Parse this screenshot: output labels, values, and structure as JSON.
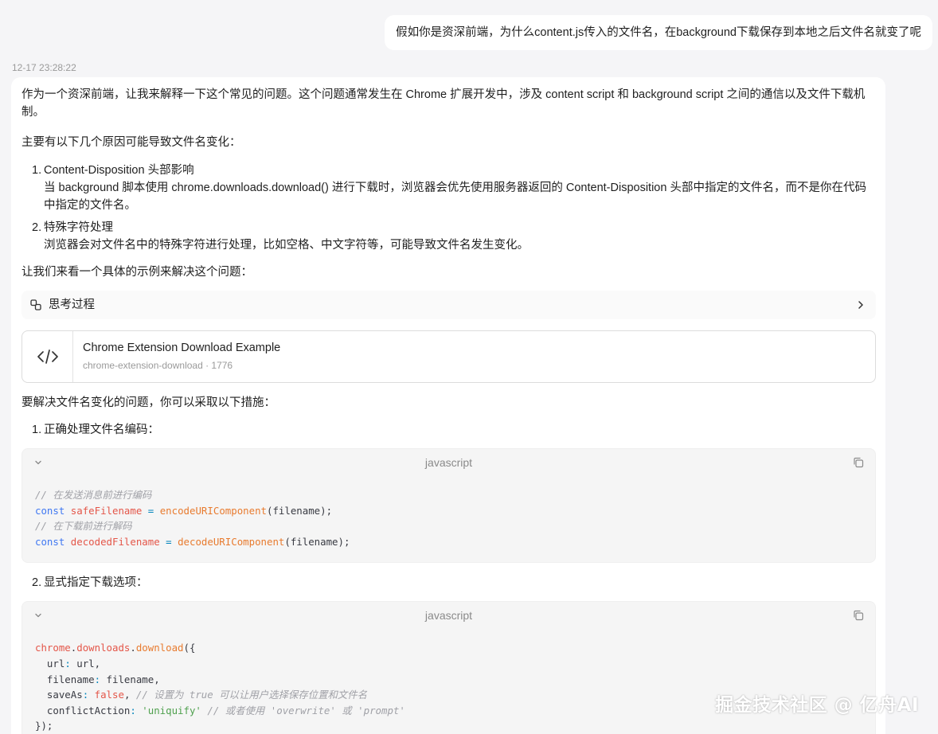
{
  "user_message": "假如你是资深前端，为什么content.js传入的文件名，在background下载保存到本地之后文件名就变了呢",
  "timestamp": "12-17 23:28:22",
  "answer": {
    "intro": "作为一个资深前端，让我来解释一下这个常见的问题。这个问题通常发生在 Chrome 扩展开发中，涉及 content script 和 background script 之间的通信以及文件下载机制。",
    "causes_lead": "主要有以下几个原因可能导致文件名变化：",
    "causes": [
      {
        "num": "1.",
        "title": "Content-Disposition 头部影响",
        "detail": "当 background 脚本使用 chrome.downloads.download() 进行下载时，浏览器会优先使用服务器返回的 Content-Disposition 头部中指定的文件名，而不是你在代码中指定的文件名。"
      },
      {
        "num": "2.",
        "title": "特殊字符处理",
        "detail": "浏览器会对文件名中的特殊字符进行处理，比如空格、中文字符等，可能导致文件名发生变化。"
      }
    ],
    "example_lead": "让我们来看一个具体的示例来解决这个问题：",
    "thinking_label": "思考过程",
    "artifact": {
      "title": "Chrome Extension Download Example",
      "subtitle": "chrome-extension-download · 1776"
    },
    "fix_lead": "要解决文件名变化的问题，你可以采取以下措施：",
    "steps": [
      {
        "num": "1.",
        "label": "正确处理文件名编码："
      },
      {
        "num": "2.",
        "label": "显式指定下载选项："
      }
    ],
    "code_blocks": [
      {
        "lang": "javascript",
        "lines": [
          [
            [
              "c-cm",
              "// 在发送消息前进行编码"
            ]
          ],
          [
            [
              "c-kw",
              "const"
            ],
            [
              "c-pl",
              " "
            ],
            [
              "c-var",
              "safeFilename"
            ],
            [
              "c-pl",
              " "
            ],
            [
              "c-op",
              "="
            ],
            [
              "c-pl",
              " "
            ],
            [
              "c-fn",
              "encodeURIComponent"
            ],
            [
              "c-pl",
              "(filename);"
            ]
          ],
          [
            [
              "c-cm",
              "// 在下载前进行解码"
            ]
          ],
          [
            [
              "c-kw",
              "const"
            ],
            [
              "c-pl",
              " "
            ],
            [
              "c-var",
              "decodedFilename"
            ],
            [
              "c-pl",
              " "
            ],
            [
              "c-op",
              "="
            ],
            [
              "c-pl",
              " "
            ],
            [
              "c-fn",
              "decodeURIComponent"
            ],
            [
              "c-pl",
              "(filename);"
            ]
          ]
        ]
      },
      {
        "lang": "javascript",
        "lines": [
          [
            [
              "c-var",
              "chrome"
            ],
            [
              "c-pl",
              "."
            ],
            [
              "c-var",
              "downloads"
            ],
            [
              "c-pl",
              "."
            ],
            [
              "c-fn",
              "download"
            ],
            [
              "c-pl",
              "({"
            ]
          ],
          [
            [
              "c-pl",
              "  url"
            ],
            [
              "c-op",
              ":"
            ],
            [
              "c-pl",
              " url,"
            ]
          ],
          [
            [
              "c-pl",
              "  filename"
            ],
            [
              "c-op",
              ":"
            ],
            [
              "c-pl",
              " filename,"
            ]
          ],
          [
            [
              "c-pl",
              "  saveAs"
            ],
            [
              "c-op",
              ":"
            ],
            [
              "c-pl",
              " "
            ],
            [
              "c-var",
              "false"
            ],
            [
              "c-pl",
              ", "
            ],
            [
              "c-cm",
              "// 设置为 true 可以让用户选择保存位置和文件名"
            ]
          ],
          [
            [
              "c-pl",
              "  conflictAction"
            ],
            [
              "c-op",
              ":"
            ],
            [
              "c-pl",
              " "
            ],
            [
              "c-str",
              "'uniquify'"
            ],
            [
              "c-pl",
              " "
            ],
            [
              "c-cm",
              "// 或者使用 'overwrite' 或 'prompt'"
            ]
          ],
          [
            [
              "c-pl",
              "});"
            ]
          ]
        ]
      }
    ]
  },
  "watermark": "掘金技术社区 @ 亿舟AI",
  "icons": {
    "thinking": "thinking-process-icon",
    "chevron": "chevron-right-icon",
    "artifact": "code-icon",
    "collapse": "chevron-down-icon",
    "copy": "copy-icon"
  }
}
